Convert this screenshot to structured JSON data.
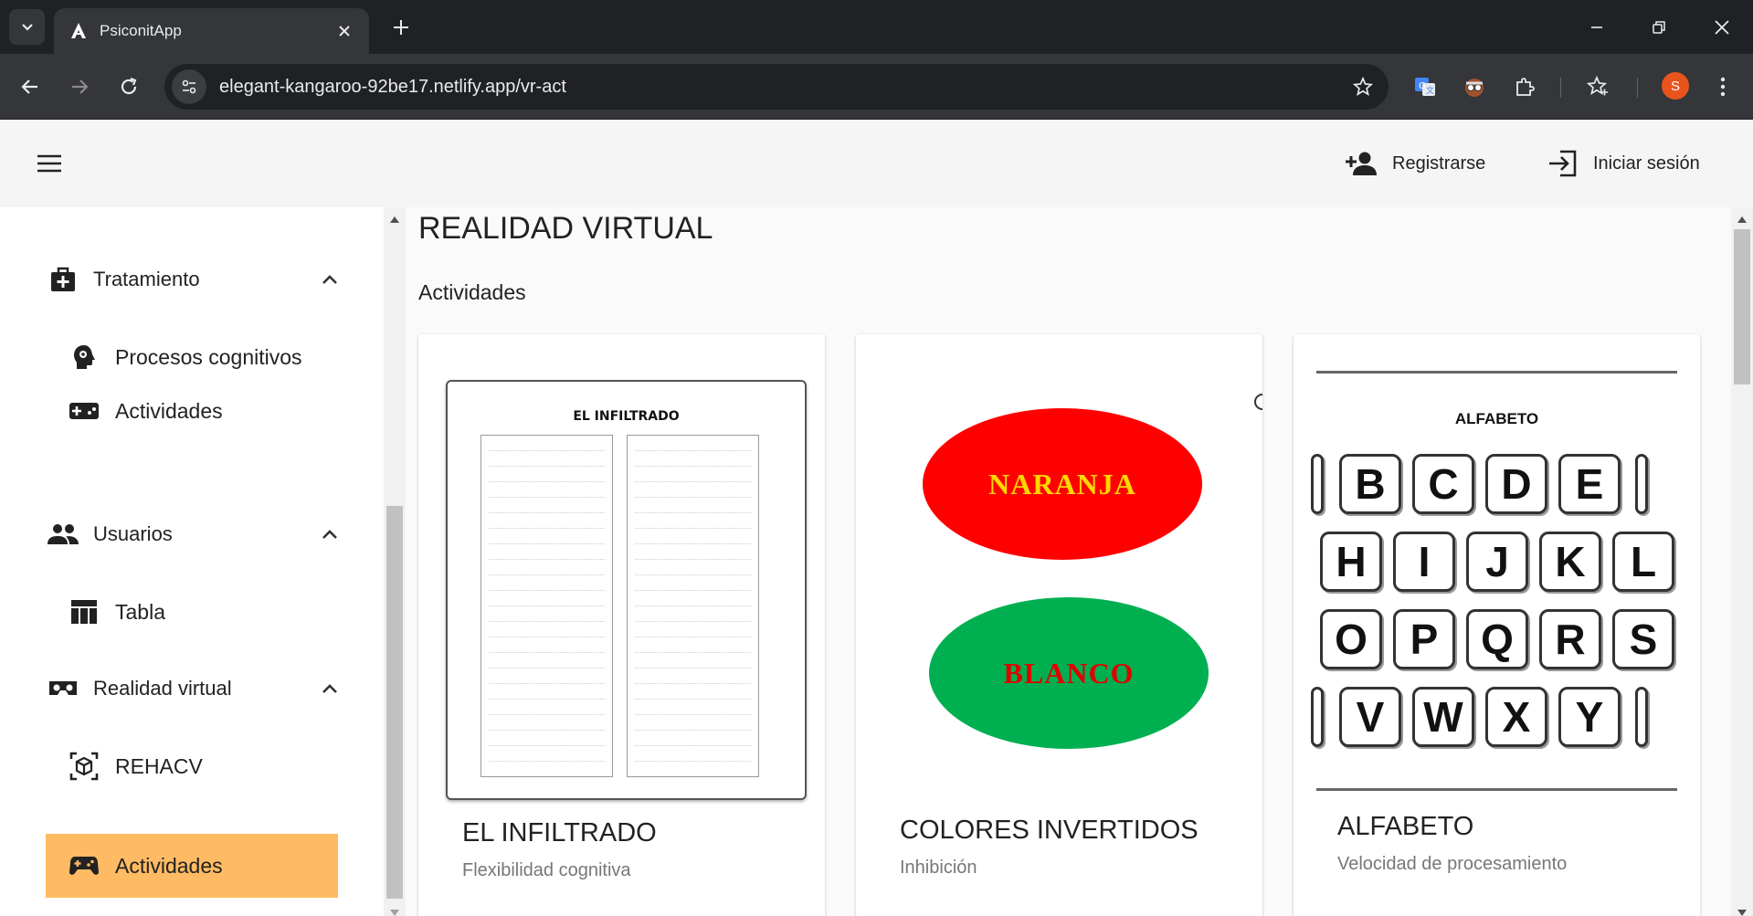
{
  "browser": {
    "tab_title": "PsiconitApp",
    "url": "elegant-kangaroo-92be17.netlify.app/vr-act",
    "profile_initial": "S"
  },
  "header": {
    "register_label": "Registrarse",
    "login_label": "Iniciar sesión"
  },
  "sidebar": {
    "sections": [
      {
        "label": "Tratamiento",
        "icon": "medical-bag-icon",
        "items": [
          {
            "label": "Procesos cognitivos",
            "icon": "psychology-icon"
          },
          {
            "label": "Actividades",
            "icon": "gamepad-icon"
          }
        ]
      },
      {
        "label": "Usuarios",
        "icon": "people-icon",
        "items": [
          {
            "label": "Tabla",
            "icon": "table-icon"
          }
        ]
      },
      {
        "label": "Realidad virtual",
        "icon": "vr-headset-icon",
        "items": [
          {
            "label": "REHACV",
            "icon": "3d-box-icon"
          },
          {
            "label": "Actividades",
            "icon": "gamepad-icon",
            "active": true
          }
        ]
      }
    ]
  },
  "main": {
    "title": "REALIDAD VIRTUAL",
    "subtitle": "Actividades",
    "cards": [
      {
        "title": "EL INFILTRADO",
        "subtitle": "Flexibilidad cognitiva",
        "image_heading": "EL INFILTRADO"
      },
      {
        "title": "COLORES INVERTIDOS",
        "subtitle": "Inhibición",
        "image_words": [
          "NARANJA",
          "BLANCO"
        ]
      },
      {
        "title": "ALFABETO",
        "subtitle": "Velocidad de procesamiento",
        "image_heading": "ALFABETO",
        "image_letters": [
          [
            "B",
            "C",
            "D",
            "E"
          ],
          [
            "H",
            "I",
            "J",
            "K",
            "L"
          ],
          [
            "O",
            "P",
            "Q",
            "R",
            "S"
          ],
          [
            "V",
            "W",
            "X",
            "Y"
          ]
        ]
      }
    ]
  },
  "colors": {
    "active_item": "#ffbb63",
    "oval_red": "#ff0000",
    "oval_green": "#00b050",
    "oval_text_yellow": "#ffd700",
    "oval_text_red": "#e00000"
  }
}
